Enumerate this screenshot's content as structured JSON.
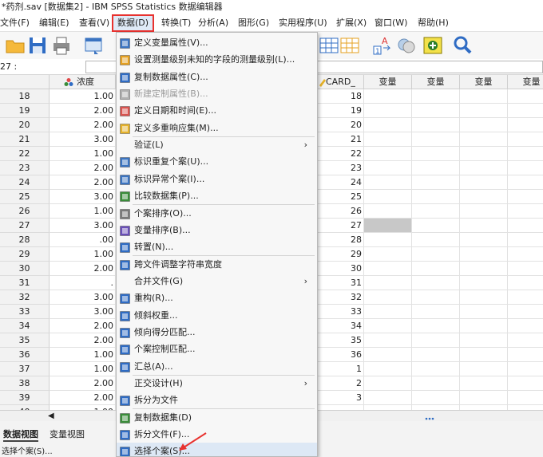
{
  "window": {
    "title": "*药剂.sav [数据集2] - IBM SPSS Statistics 数据编辑器"
  },
  "menubar": {
    "items": [
      {
        "label": "文件(F)"
      },
      {
        "label": "编辑(E)"
      },
      {
        "label": "查看(V)"
      },
      {
        "label": "数据(D)"
      },
      {
        "label": "转换(T)"
      },
      {
        "label": "分析(A)"
      },
      {
        "label": "图形(G)"
      },
      {
        "label": "实用程序(U)"
      },
      {
        "label": "扩展(X)"
      },
      {
        "label": "窗口(W)"
      },
      {
        "label": "帮助(H)"
      }
    ]
  },
  "cellbar": {
    "ref": "27 :"
  },
  "grid": {
    "headers": {
      "col1": "浓度",
      "card": "CARD_",
      "var1": "变量",
      "var2": "变量",
      "var3": "变量",
      "var4": "变量"
    },
    "rows": [
      {
        "n": "18",
        "v": "1.00",
        "card": "18"
      },
      {
        "n": "19",
        "v": "2.00",
        "card": "19"
      },
      {
        "n": "20",
        "v": "2.00",
        "card": "20"
      },
      {
        "n": "21",
        "v": "3.00",
        "card": "21"
      },
      {
        "n": "22",
        "v": "1.00",
        "card": "22"
      },
      {
        "n": "23",
        "v": "2.00",
        "card": "23"
      },
      {
        "n": "24",
        "v": "2.00",
        "card": "24"
      },
      {
        "n": "25",
        "v": "3.00",
        "card": "25"
      },
      {
        "n": "26",
        "v": "1.00",
        "card": "26"
      },
      {
        "n": "27",
        "v": "3.00",
        "card": "27"
      },
      {
        "n": "28",
        "v": ".00",
        "card": "28"
      },
      {
        "n": "29",
        "v": "1.00",
        "card": "29"
      },
      {
        "n": "30",
        "v": "2.00",
        "card": "30"
      },
      {
        "n": "31",
        "v": ".",
        "card": "31"
      },
      {
        "n": "32",
        "v": "3.00",
        "card": "32"
      },
      {
        "n": "33",
        "v": "3.00",
        "card": "33"
      },
      {
        "n": "34",
        "v": "2.00",
        "card": "34"
      },
      {
        "n": "35",
        "v": "2.00",
        "card": "35"
      },
      {
        "n": "36",
        "v": "1.00",
        "card": "36"
      },
      {
        "n": "37",
        "v": "1.00",
        "card": "1"
      },
      {
        "n": "38",
        "v": "2.00",
        "card": "2"
      },
      {
        "n": "39",
        "v": "2.00",
        "card": "3"
      },
      {
        "n": "40",
        "v": "1.00",
        "card": "."
      }
    ]
  },
  "tabs": {
    "data_view": "数据视图",
    "variable_view": "变量视图"
  },
  "status": {
    "text": "选择个案(S)..."
  },
  "dropdown": {
    "items": [
      {
        "label": "定义变量属性(V)...",
        "icon": "define-properties-icon"
      },
      {
        "label": "设置测量级别未知的字段的测量级别(L)...",
        "icon": "measure-level-icon"
      },
      {
        "label": "复制数据属性(C)...",
        "icon": "copy-properties-icon"
      },
      {
        "label": "新建定制属性(B)...",
        "icon": "custom-attribute-icon",
        "disabled": true
      },
      {
        "label": "定义日期和时间(E)...",
        "icon": "calendar-icon"
      },
      {
        "label": "定义多重响应集(M)...",
        "icon": "multiple-response-icon"
      },
      {
        "label": "验证(L)",
        "submenu": true
      },
      {
        "label": "标识重复个案(U)...",
        "icon": "duplicate-cases-icon"
      },
      {
        "label": "标识异常个案(I)...",
        "icon": "unusual-cases-icon"
      },
      {
        "label": "比较数据集(P)...",
        "icon": "compare-datasets-icon"
      },
      {
        "label": "个案排序(O)...",
        "icon": "sort-cases-icon"
      },
      {
        "label": "变量排序(B)...",
        "icon": "sort-variables-icon"
      },
      {
        "label": "转置(N)...",
        "icon": "transpose-icon"
      },
      {
        "label": "跨文件调整字符串宽度",
        "icon": "string-width-icon"
      },
      {
        "label": "合并文件(G)",
        "submenu": true
      },
      {
        "label": "重构(R)...",
        "icon": "restructure-icon"
      },
      {
        "label": "倾斜权重...",
        "icon": "rake-weights-icon"
      },
      {
        "label": "倾向得分匹配...",
        "icon": "propensity-match-icon"
      },
      {
        "label": "个案控制匹配...",
        "icon": "case-control-icon"
      },
      {
        "label": "汇总(A)...",
        "icon": "aggregate-icon"
      },
      {
        "label": "正交设计(H)",
        "submenu": true
      },
      {
        "label": "拆分为文件",
        "icon": "split-to-files-icon"
      },
      {
        "label": "复制数据集(D)",
        "icon": "copy-dataset-icon"
      },
      {
        "label": "拆分文件(F)...",
        "icon": "split-file-icon"
      },
      {
        "label": "选择个案(S)...",
        "icon": "select-cases-icon"
      }
    ]
  },
  "colors": {
    "menu_highlight_border": "#e8322f",
    "arrow": "#e8322f",
    "selected_cell": "#c8c8c8"
  }
}
